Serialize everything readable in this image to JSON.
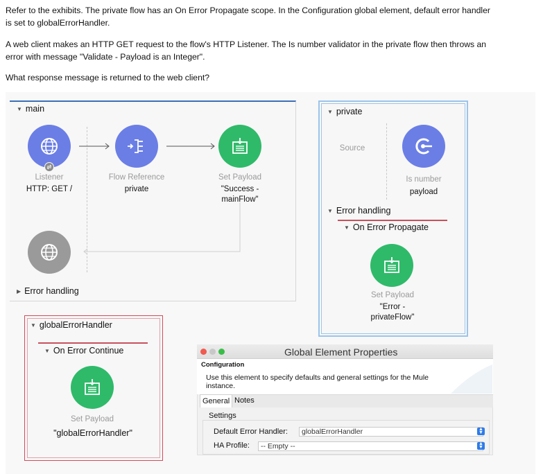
{
  "question": {
    "line1": "Refer to the exhibits. The private flow has an On Error Propagate scope. In the Configuration global element, default error handler",
    "line2": "is set to globalErrorHandler.",
    "line3": "A web client makes an HTTP GET request to the flow's HTTP Listener. The Is number validator in the private flow then throws an",
    "line4": "error with message \"Validate - Payload is an Integer\".",
    "line5": "What response message is returned to the web client?"
  },
  "main_flow": {
    "title": "main",
    "listener": {
      "type": "Listener",
      "value": "HTTP: GET /"
    },
    "flow_ref": {
      "type": "Flow Reference",
      "value": "private"
    },
    "set_payload": {
      "type": "Set Payload",
      "value_line1": "\"Success -",
      "value_line2": "mainFlow\""
    },
    "error_handling": "Error handling"
  },
  "private_flow": {
    "title": "private",
    "source": "Source",
    "is_number": {
      "type": "Is number",
      "value": "payload"
    },
    "error_handling": "Error handling",
    "on_error": "On Error Propagate",
    "set_payload": {
      "type": "Set Payload",
      "value_line1": "\"Error -",
      "value_line2": "privateFlow\""
    }
  },
  "global_error_handler": {
    "title": "globalErrorHandler",
    "on_error": "On Error Continue",
    "set_payload": {
      "type": "Set Payload",
      "value": "\"globalErrorHandler\""
    }
  },
  "global_element_properties": {
    "window_title": "Global Element Properties",
    "heading": "Configuration",
    "description_line1": "Use this element to specify defaults and general settings for the Mule",
    "description_line2": "instance.",
    "tabs": [
      "General",
      "Notes"
    ],
    "settings_label": "Settings",
    "default_error_handler_label": "Default Error Handler:",
    "default_error_handler_value": "globalErrorHandler",
    "ha_profile_label": "HA Profile:",
    "ha_profile_value": "-- Empty --"
  },
  "colors": {
    "connector_blue": "#6b7ee6",
    "processor_green": "#2fba6a",
    "error_red": "#d14b5c",
    "flow_border_blue": "#3b6fb6"
  }
}
